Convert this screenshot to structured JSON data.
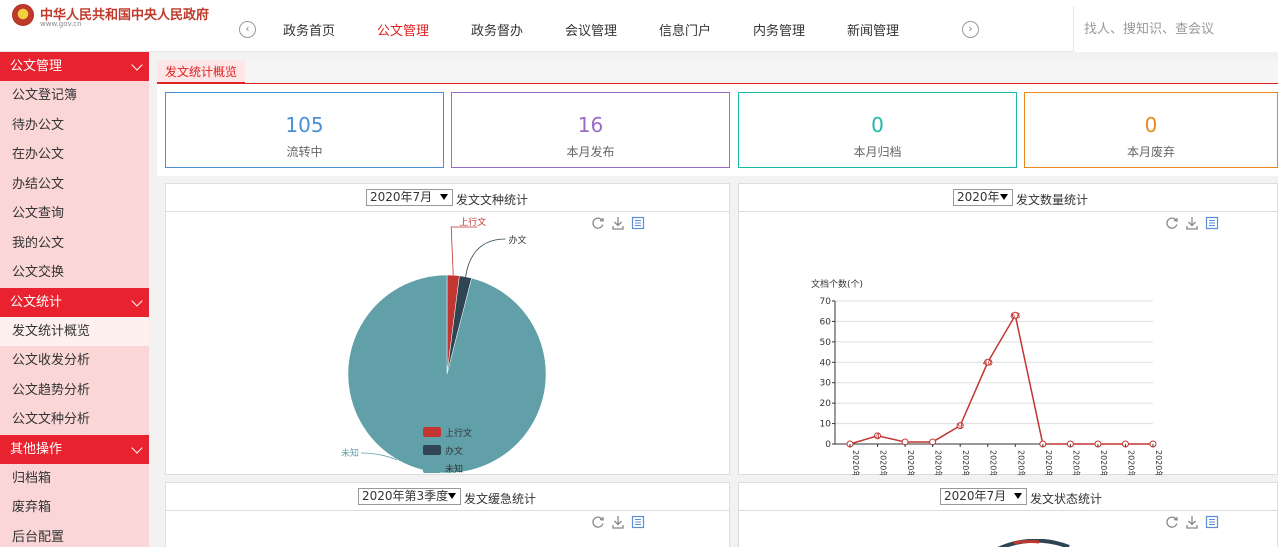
{
  "header": {
    "title": "中华人民共和国中央人民政府",
    "subtitle": "www.gov.cn",
    "nav_prev": "‹",
    "nav_next": "›",
    "nav": [
      "政务首页",
      "公文管理",
      "政务督办",
      "会议管理",
      "信息门户",
      "内务管理",
      "新闻管理"
    ],
    "active_nav": 1,
    "search_placeholder": "找人、搜知识、查会议"
  },
  "sidebar": {
    "sections": [
      {
        "title": "公文管理",
        "items": [
          "公文登记簿",
          "待办公文",
          "在办公文",
          "办结公文",
          "公文查询",
          "我的公文",
          "公文交换"
        ]
      },
      {
        "title": "公文统计",
        "items": [
          "发文统计概览",
          "公文收发分析",
          "公文趋势分析",
          "公文文种分析"
        ]
      },
      {
        "title": "其他操作",
        "items": [
          "归档箱",
          "废弃箱",
          "后台配置"
        ]
      }
    ],
    "active_item": "发文统计概览"
  },
  "tab": {
    "label": "发文统计概览"
  },
  "stats": [
    {
      "value": "105",
      "label": "流转中",
      "color": "#4a8fd8",
      "border": "#4a8fd8"
    },
    {
      "value": "16",
      "label": "本月发布",
      "color": "#9a6cc9",
      "border": "#9a6cc9"
    },
    {
      "value": "0",
      "label": "本月归档",
      "color": "#1bb9a8",
      "border": "#1bb9a8"
    },
    {
      "value": "0",
      "label": "本月废弃",
      "color": "#e8891a",
      "border": "#e8891a"
    }
  ],
  "panels": {
    "type": {
      "select": "2020年7月",
      "title": "发文文种统计"
    },
    "count": {
      "select": "2020年",
      "title": "发文数量统计"
    },
    "urgency": {
      "select": "2020年第3季度",
      "title": "发文缓急统计"
    },
    "status": {
      "select": "2020年7月",
      "title": "发文状态统计"
    }
  },
  "tool_icons": [
    "refresh-icon",
    "download-icon",
    "data-view-icon"
  ],
  "chart_data": [
    {
      "type": "pie",
      "labels": [
        "上行文",
        "办文",
        "未知"
      ],
      "values": [
        2,
        2,
        96
      ],
      "colors": [
        "#c23531",
        "#2f4554",
        "#61a0a8"
      ],
      "legend": "bottom-center"
    },
    {
      "type": "line",
      "ylabel": "文档个数(个)",
      "categories": [
        "2020年1月",
        "2020年2月",
        "2020年3月",
        "2020年4月",
        "2020年5月",
        "2020年6月",
        "2020年7月",
        "2020年8月",
        "2020年9月",
        "2020年10月",
        "2020年11月",
        "2020年12月"
      ],
      "values": [
        0,
        4,
        1,
        1,
        9,
        40,
        63,
        0,
        0,
        0,
        0,
        0
      ],
      "yticks": [
        0,
        10,
        20,
        30,
        40,
        50,
        60,
        70
      ],
      "ylim": [
        0,
        70
      ],
      "color": "#c23531",
      "labeled_points": [
        "4",
        "9",
        "40",
        "63"
      ],
      "grid": true
    }
  ]
}
